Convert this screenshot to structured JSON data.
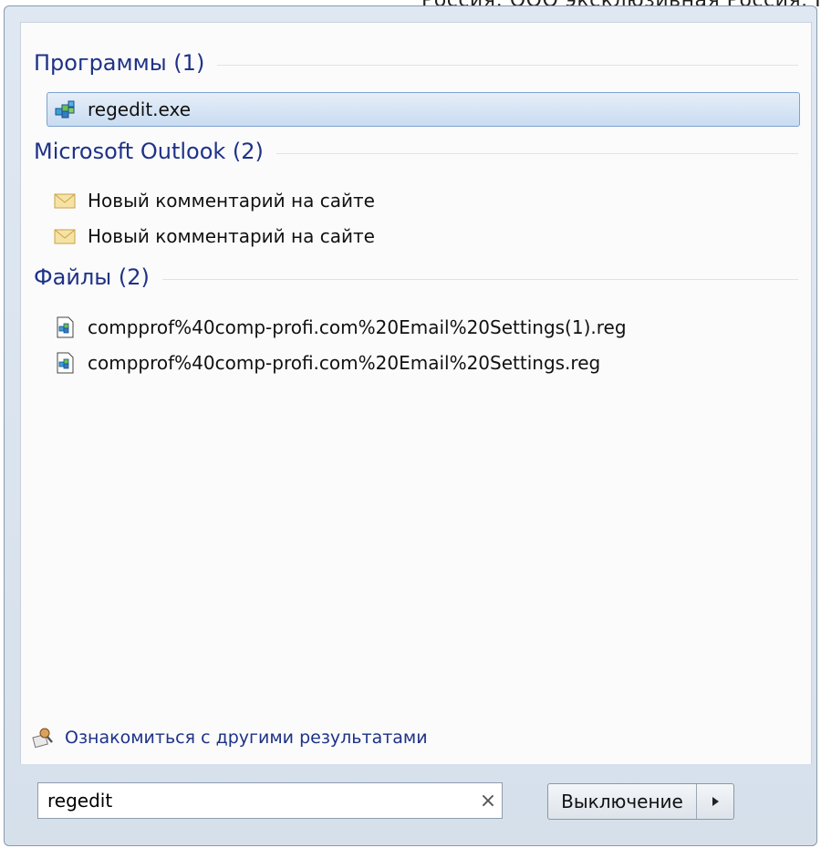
{
  "background_text": "Россия: ООО эксклюзивная Россия. Ге",
  "sections": [
    {
      "title": "Программы (1)",
      "items": [
        {
          "label": "regedit.exe",
          "icon": "registry-editor-icon",
          "selected": true
        }
      ]
    },
    {
      "title": "Microsoft Outlook (2)",
      "items": [
        {
          "label": "Новый комментарий на сайте",
          "icon": "envelope-icon"
        },
        {
          "label": "Новый комментарий на сайте",
          "icon": "envelope-icon"
        }
      ]
    },
    {
      "title": "Файлы (2)",
      "items": [
        {
          "label": "compprof%40comp-profi.com%20Email%20Settings(1).reg",
          "icon": "reg-file-icon"
        },
        {
          "label": "compprof%40comp-profi.com%20Email%20Settings.reg",
          "icon": "reg-file-icon"
        }
      ]
    }
  ],
  "more_results": {
    "label": "Ознакомиться с другими результатами",
    "icon": "search-more-icon"
  },
  "search": {
    "value": "regedit",
    "clear_symbol": "×"
  },
  "shutdown": {
    "label": "Выключение",
    "arrow_icon": "chevron-right-icon"
  },
  "colors": {
    "heading": "#1e3287",
    "selection": "#c9dcf2",
    "selection_border": "#7da2ce"
  }
}
